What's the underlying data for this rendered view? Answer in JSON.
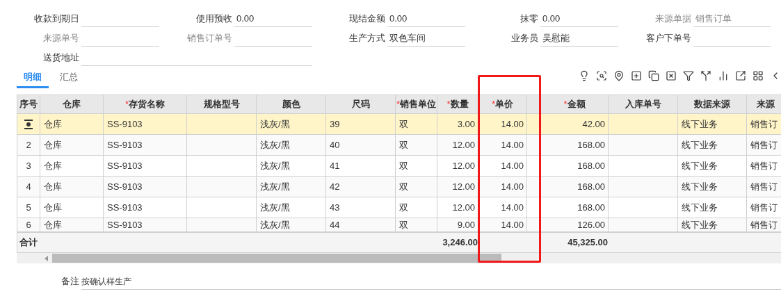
{
  "form": {
    "rows": [
      {
        "fields": [
          {
            "label": "收款到期日",
            "disabled": false,
            "kind": "normal"
          },
          {
            "label": "使用预收",
            "value": "0.00",
            "disabled": false,
            "kind": "normal"
          },
          {
            "label": "现结金额",
            "value": "0.00",
            "disabled": false,
            "kind": "normal"
          },
          {
            "label": "抹零",
            "value": "0.00",
            "disabled": false,
            "kind": "normal"
          },
          {
            "label": "来源单据",
            "value": "销售订单",
            "disabled": true,
            "kind": "normal"
          }
        ]
      },
      {
        "fields": [
          {
            "label": "来源单号",
            "disabled": true,
            "kind": "normal"
          },
          {
            "label": "销售订单号",
            "disabled": true,
            "kind": "normal"
          },
          {
            "label": "生产方式",
            "value": "双色车间",
            "disabled": false,
            "kind": "normal"
          },
          {
            "label": "业务员",
            "value": "吴慰能",
            "disabled": false,
            "kind": "normal"
          },
          {
            "label": "客户下单号",
            "disabled": false,
            "kind": "normal"
          }
        ]
      },
      {
        "fields": [
          {
            "label": "送货地址",
            "disabled": false,
            "kind": "wide"
          }
        ]
      }
    ]
  },
  "tabs": [
    {
      "label": "明细",
      "selected": true
    },
    {
      "label": "汇总",
      "selected": false
    }
  ],
  "table": {
    "columns": [
      {
        "label": "序号",
        "kind": "index"
      },
      {
        "label": "仓库",
        "kind": "text"
      },
      {
        "label": "存货名称",
        "marker": "*",
        "kind": "text"
      },
      {
        "label": "规格型号",
        "kind": "text"
      },
      {
        "label": "颜色",
        "kind": "text"
      },
      {
        "label": "尺码",
        "kind": "text"
      },
      {
        "label": "销售单位",
        "marker": "*",
        "kind": "text"
      },
      {
        "label": "数量",
        "marker": "*",
        "kind": "number",
        "total": "3,246.00"
      },
      {
        "label": "单价",
        "marker": "*",
        "kind": "number"
      },
      {
        "kind": "text"
      },
      {
        "label": "金额",
        "marker": "*",
        "kind": "number",
        "total": "45,325.00"
      },
      {
        "label": "入库单号",
        "kind": "text"
      },
      {
        "label": "数据来源",
        "kind": "text"
      },
      {
        "label": "来源",
        "kind": "text"
      }
    ],
    "rows": [
      {
        "selected": true,
        "cells": [
          "",
          "仓库",
          "SS-9103",
          "",
          "浅灰/黑",
          "39",
          "双",
          "3.00",
          "14.00",
          "",
          "42.00",
          "",
          "线下业务",
          "销售订"
        ]
      },
      {
        "selected": false,
        "cells": [
          "2",
          "仓库",
          "SS-9103",
          "",
          "浅灰/黑",
          "40",
          "双",
          "12.00",
          "14.00",
          "",
          "168.00",
          "",
          "线下业务",
          "销售订"
        ]
      },
      {
        "selected": false,
        "cells": [
          "3",
          "仓库",
          "SS-9103",
          "",
          "浅灰/黑",
          "41",
          "双",
          "12.00",
          "14.00",
          "",
          "168.00",
          "",
          "线下业务",
          "销售订"
        ]
      },
      {
        "selected": false,
        "cells": [
          "4",
          "仓库",
          "SS-9103",
          "",
          "浅灰/黑",
          "42",
          "双",
          "12.00",
          "14.00",
          "",
          "168.00",
          "",
          "线下业务",
          "销售订"
        ]
      },
      {
        "selected": false,
        "cells": [
          "5",
          "仓库",
          "SS-9103",
          "",
          "浅灰/黑",
          "43",
          "双",
          "12.00",
          "14.00",
          "",
          "168.00",
          "",
          "线下业务",
          "销售订"
        ]
      },
      {
        "selected": false,
        "cells": [
          "6",
          "仓库",
          "SS-9103",
          "",
          "浅灰/黑",
          "44",
          "双",
          "9.00",
          "14.00",
          "",
          "126.00",
          "",
          "线下业务",
          "销售订"
        ]
      }
    ],
    "total_label": "合计"
  },
  "remark": {
    "label": "备注",
    "value": "按确认样生产"
  }
}
